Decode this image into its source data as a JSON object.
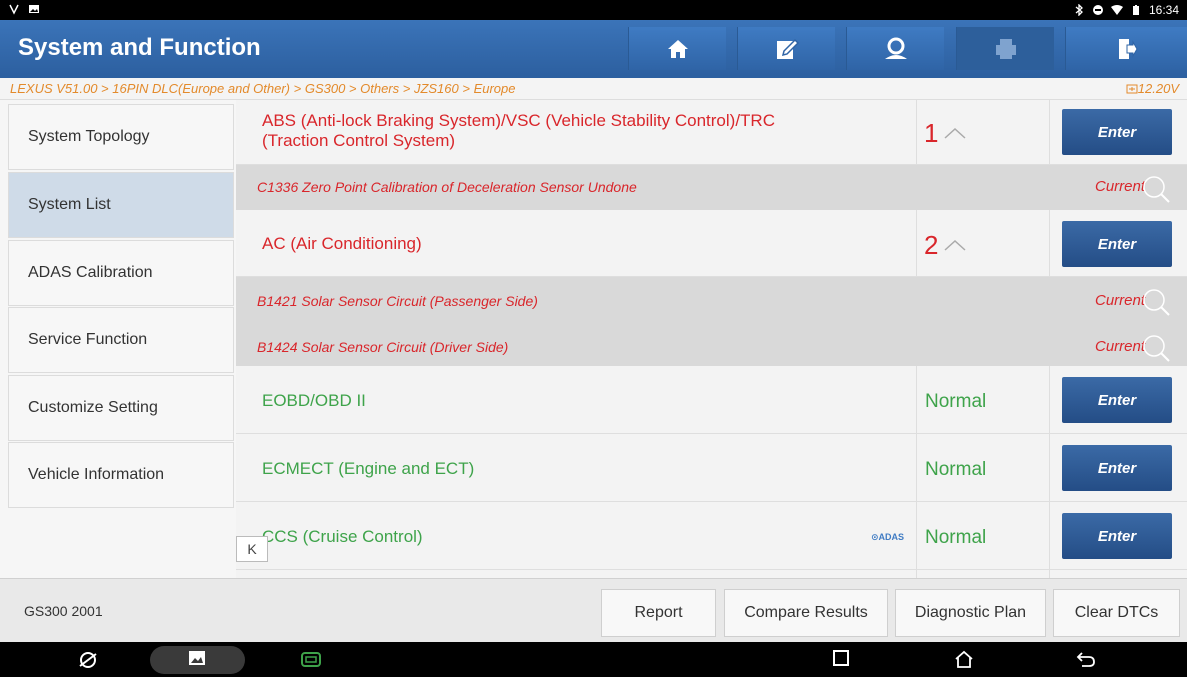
{
  "status_bar": {
    "time": "16:34"
  },
  "header": {
    "title": "System and Function",
    "buttons": [
      {
        "icon": "home-icon"
      },
      {
        "icon": "edit-note-icon"
      },
      {
        "icon": "user-support-icon"
      },
      {
        "icon": "print-icon"
      },
      {
        "icon": "exit-icon"
      }
    ]
  },
  "breadcrumb": {
    "path": "LEXUS V51.00 > 16PIN DLC(Europe and Other) > GS300 > Others > JZS160 > Europe",
    "voltage": "12.20V"
  },
  "sidebar": {
    "items": [
      {
        "label": "System Topology",
        "active": false
      },
      {
        "label": "System List",
        "active": true
      },
      {
        "label": "ADAS Calibration",
        "active": false
      },
      {
        "label": "Service Function",
        "active": false
      },
      {
        "label": "Customize Setting",
        "active": false
      },
      {
        "label": "Vehicle Information",
        "active": false
      }
    ]
  },
  "systems": [
    {
      "name_line1": "ABS (Anti-lock Braking System)/VSC (Vehicle Stability Control)/TRC",
      "name_line2": "(Traction Control System)",
      "fault_count": "1",
      "button": "Enter"
    },
    {
      "name": "AC (Air Conditioning)",
      "fault_count": "2",
      "button": "Enter"
    },
    {
      "name": "EOBD/OBD II",
      "status": "Normal",
      "button": "Enter"
    },
    {
      "name": "ECMECT (Engine and ECT)",
      "status": "Normal",
      "button": "Enter"
    },
    {
      "name": "CCS (Cruise Control)",
      "status": "Normal",
      "button": "Enter",
      "tag": "ADAS"
    }
  ],
  "dtcs": [
    {
      "text": "C1336 Zero Point Calibration of Deceleration Sensor Undone",
      "state": "Current"
    },
    {
      "text": "B1421 Solar Sensor Circuit (Passenger Side)",
      "state": "Current"
    },
    {
      "text": "B1424 Solar Sensor Circuit (Driver Side)",
      "state": "Current"
    }
  ],
  "collapse_glyph": "K",
  "bottom": {
    "vehicle": "GS300 2001",
    "buttons": [
      "Report",
      "Compare Results",
      "Diagnostic Plan",
      "Clear DTCs"
    ]
  },
  "colors": {
    "title_bar": "#3b74b9",
    "fault_red": "#d9262b",
    "normal_green": "#3ea34a",
    "enter_button": "#2f5c97",
    "breadcrumb_orange": "#e38a2b"
  }
}
